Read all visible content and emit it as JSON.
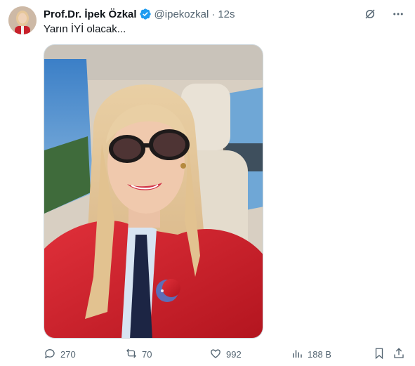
{
  "tweet": {
    "author_name": "Prof.Dr. İpek Özkal",
    "handle": "@ipekozkal",
    "separator": "·",
    "time": "12s",
    "text": "Yarın İYİ olacak...",
    "verified": true
  },
  "stats": {
    "replies": "270",
    "reposts": "70",
    "likes": "992",
    "views": "188 B"
  },
  "icons": {
    "verified": "verified-badge-icon",
    "grok": "grok-icon",
    "more": "more-icon",
    "reply": "reply-icon",
    "repost": "repost-icon",
    "like": "like-icon",
    "views": "views-icon",
    "bookmark": "bookmark-icon",
    "share": "share-icon"
  },
  "colors": {
    "verified_blue": "#1d9bf0",
    "secondary_text": "#536471",
    "primary_text": "#0f1419"
  }
}
